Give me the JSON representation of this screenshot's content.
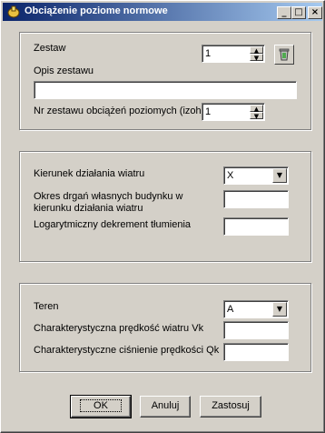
{
  "window": {
    "title": "Obciążenie poziome normowe",
    "controls": {
      "minimize": "_",
      "maximize": "□",
      "close": "×"
    }
  },
  "set_group": {
    "set_label": "Zestaw",
    "set_value": "1",
    "description_label": "Opis zestawu",
    "description_value": "",
    "horizontal_load_set_label": "Nr zestawu obciążeń poziomych (izoh)",
    "horizontal_load_set_value": "1"
  },
  "wind_group": {
    "direction_label": "Kierunek działania wiatru",
    "direction_value": "X",
    "vibration_period_label_line1": "Okres drgań własnych budynku w",
    "vibration_period_label_line2": "kierunku działania wiatru",
    "vibration_period_value": "",
    "damping_label": "Logarytmiczny dekrement tłumienia",
    "damping_value": ""
  },
  "terrain_group": {
    "terrain_label": "Teren",
    "terrain_value": "A",
    "wind_speed_label": "Charakterystyczna prędkość wiatru Vk",
    "wind_speed_value": "",
    "pressure_label": "Charakterystyczne ciśnienie prędkości Qk",
    "pressure_value": ""
  },
  "buttons": {
    "ok": "OK",
    "cancel": "Anuluj",
    "apply": "Zastosuj"
  },
  "icons": [
    "app-icon",
    "trash-icon",
    "spin-up-icon",
    "spin-down-icon",
    "dropdown-arrow-icon"
  ]
}
